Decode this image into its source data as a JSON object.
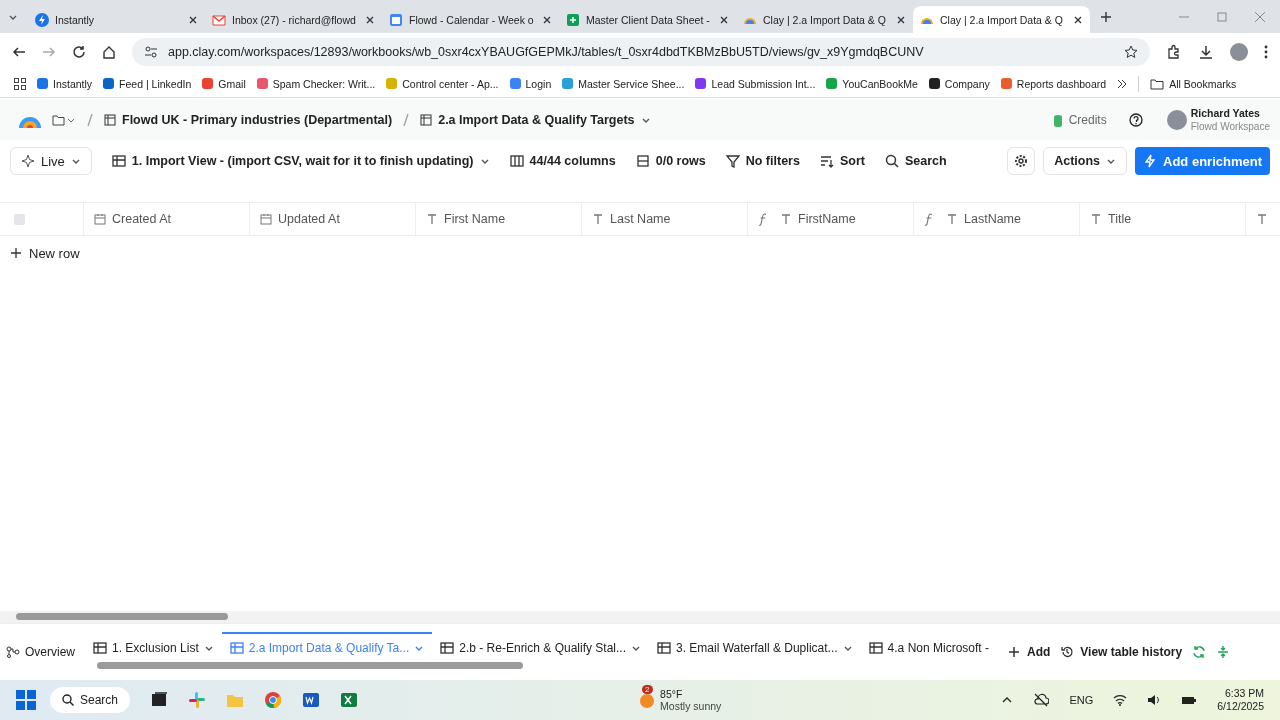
{
  "browser": {
    "tabs": [
      {
        "title": "Instantly",
        "selected": false
      },
      {
        "title": "Inbox (27) - richard@flowd",
        "selected": false
      },
      {
        "title": "Flowd - Calendar - Week o",
        "selected": false
      },
      {
        "title": "Master Client Data Sheet -",
        "selected": false
      },
      {
        "title": "Clay | 2.a Import Data & Q",
        "selected": false
      },
      {
        "title": "Clay | 2.a Import Data & Q",
        "selected": true
      }
    ],
    "url": "app.clay.com/workspaces/12893/workbooks/wb_0sxr4cxYBAUGfGEPMkJ/tables/t_0sxr4dbdTKBMzBbU5TD/views/gv_x9YgmdqBCUNV",
    "bookmarks": [
      {
        "label": "Instantly",
        "color": "#1a73e8"
      },
      {
        "label": "Feed | LinkedIn",
        "color": "#0a66c2"
      },
      {
        "label": "Gmail",
        "color": "#ea4335"
      },
      {
        "label": "Spam Checker: Writ...",
        "color": "#e8576b"
      },
      {
        "label": "Control center - Ap...",
        "color": "#d4b400"
      },
      {
        "label": "Login",
        "color": "#3b82f6"
      },
      {
        "label": "Master Service Shee...",
        "color": "#2a9fd8"
      },
      {
        "label": "Lead Submission Int...",
        "color": "#7c3aed"
      },
      {
        "label": "YouCanBookMe",
        "color": "#16a34a"
      },
      {
        "label": "Company",
        "color": "#222222"
      },
      {
        "label": "Reports dashboard",
        "color": "#e85d2a"
      }
    ],
    "all_bookmarks": "All Bookmarks"
  },
  "app": {
    "breadcrumb": [
      "Flowd UK - Primary industries (Departmental)",
      "2.a Import Data & Qualify Targets"
    ],
    "credits": "Credits",
    "user": {
      "name": "Richard Yates",
      "workspace": "Flowd Workspace"
    },
    "toolbar": {
      "live": "Live",
      "view": "1. Import View - (import CSV, wait for it to finish updating)",
      "columns": "44/44 columns",
      "rows": "0/0 rows",
      "filters": "No filters",
      "sort": "Sort",
      "search": "Search",
      "actions": "Actions",
      "add_enrichment": "Add enrichment"
    },
    "table": {
      "columns": [
        {
          "name": "Created At",
          "kind": "date"
        },
        {
          "name": "Updated At",
          "kind": "date"
        },
        {
          "name": "First Name",
          "kind": "text"
        },
        {
          "name": "Last Name",
          "kind": "text"
        },
        {
          "name": "FirstName",
          "kind": "formula"
        },
        {
          "name": "LastName",
          "kind": "formula"
        },
        {
          "name": "Title",
          "kind": "text"
        },
        {
          "kind": "text"
        }
      ],
      "select_all": {
        "checked": false
      },
      "new_row": "New row"
    },
    "overview": "Overview",
    "sheet_tabs": [
      {
        "label": "1. Exclusion List",
        "selected": false
      },
      {
        "label": "2.a Import Data & Qualify Ta...",
        "selected": true
      },
      {
        "label": "2.b - Re-Enrich & Qualify Stal...",
        "selected": false
      },
      {
        "label": "3. Email Waterfall & Duplicat...",
        "selected": false
      },
      {
        "label": "4.a Non Microsoft -",
        "selected": false
      }
    ],
    "add": "Add",
    "history": "View table history"
  },
  "taskbar": {
    "search": "Search",
    "weather": {
      "badge": "2",
      "temp": "85°F",
      "text": "Mostly sunny"
    },
    "lang": "ENG",
    "time": "6:33 PM",
    "date": "6/12/2025"
  }
}
